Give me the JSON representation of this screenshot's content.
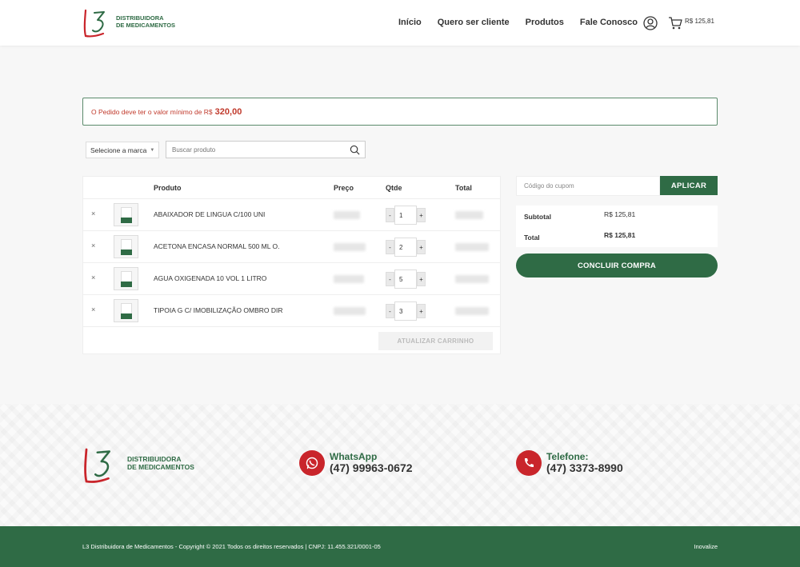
{
  "header": {
    "logo_text_line1": "Distribuidora",
    "logo_text_line2": "de Medicamentos",
    "nav": [
      "Início",
      "Quero ser cliente",
      "Produtos",
      "Fale Conosco"
    ],
    "cart_total": "R$ 125,81"
  },
  "notice": {
    "text": "O Pedido deve ter o valor mínimo de R$",
    "amount": "320,00"
  },
  "filters": {
    "brand_select": "Selecione a marca",
    "search_placeholder": "Buscar produto"
  },
  "cart": {
    "columns": [
      "Produto",
      "Preço",
      "Qtde",
      "Total"
    ],
    "items": [
      {
        "name": "ABAIXADOR DE LINGUA C/100 UNI",
        "qty": "1"
      },
      {
        "name": "ACETONA ENCASA NORMAL 500 ML O.",
        "qty": "2"
      },
      {
        "name": "AGUA OXIGENADA 10 VOL 1 LITRO",
        "qty": "5"
      },
      {
        "name": "TIPOIA G C/ IMOBILIZAÇÃO OMBRO DIR",
        "qty": "3"
      }
    ],
    "remove_symbol": "×",
    "minus": "-",
    "plus": "+",
    "update_label": "Atualizar carrinho"
  },
  "summary": {
    "coupon_placeholder": "Código do cupom",
    "apply_label": "APLICAR",
    "subtotal_label": "Subtotal",
    "subtotal_value": "R$ 125,81",
    "total_label": "Total",
    "total_value": "R$ 125,81",
    "checkout_label": "CONCLUIR COMPRA"
  },
  "footer": {
    "logo_line1": "Distribuidora",
    "logo_line2": "de Medicamentos",
    "whatsapp_label": "WhatsApp",
    "whatsapp_number": "(47) 99963-0672",
    "phone_label": "Telefone:",
    "phone_number": "(47) 3373-8990",
    "copyright": "L3 Distribuidora de Medicamentos - Copyright © 2021 Todos os direitos reservados | CNPJ: 11.455.321/0001-05",
    "credit": "Inovalize"
  },
  "colors": {
    "brand_green": "#2f6b45",
    "brand_red": "#c9252b"
  }
}
